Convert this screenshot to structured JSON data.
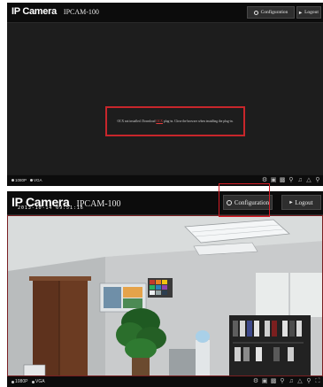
{
  "top": {
    "brand": "IP Camera",
    "model": "IPCAM-100",
    "config_label": "Configuration",
    "logout_label": "Logout",
    "message": {
      "part1": "OCX not installed. Download",
      "link": "OCX",
      "part2": "plug-in. Close the browser when installing the plug-in."
    },
    "res_hd": "1080P",
    "res_vga": "VGA"
  },
  "bottom": {
    "brand": "IP Camera",
    "model": "IPCAM-100",
    "config_label": "Configuration",
    "logout_label": "Logout",
    "timestamp": "2013-10-14 09:51:16",
    "res_hd": "1080P",
    "res_vga": "VGA"
  },
  "icons": [
    "settings-icon",
    "record-icon",
    "snapshot-icon",
    "microphone-icon",
    "speaker-icon",
    "alarm-icon",
    "zoom-icon",
    "fullscreen-icon"
  ],
  "colors": {
    "accent": "#c8262b",
    "header": "#0c0c0c"
  }
}
